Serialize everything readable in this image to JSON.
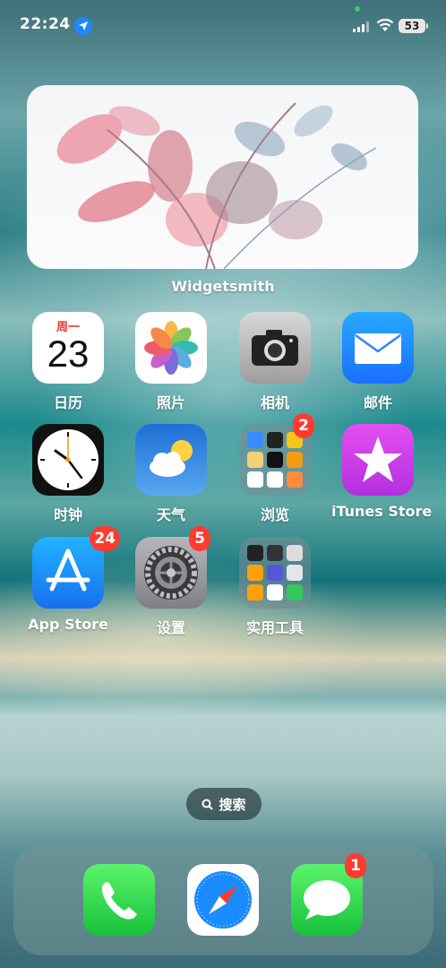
{
  "status_bar": {
    "time": "22:24",
    "battery": "53",
    "icons": [
      "location-icon",
      "signal-icon",
      "wifi-icon",
      "battery-icon"
    ]
  },
  "widget": {
    "label": "Widgetsmith"
  },
  "apps": {
    "calendar": {
      "label": "日历",
      "weekday": "周一",
      "date": "23"
    },
    "photos": {
      "label": "照片"
    },
    "camera": {
      "label": "相机"
    },
    "mail": {
      "label": "邮件"
    },
    "clock": {
      "label": "时钟"
    },
    "weather": {
      "label": "天气"
    },
    "browse": {
      "label": "浏览",
      "badge": "2"
    },
    "itunes": {
      "label": "iTunes Store"
    },
    "appstore": {
      "label": "App Store",
      "badge": "24"
    },
    "settings": {
      "label": "设置",
      "badge": "5"
    },
    "utilities": {
      "label": "实用工具"
    }
  },
  "search": {
    "label": "搜索"
  },
  "dock": {
    "phone": {
      "icon": "phone-icon"
    },
    "safari": {
      "icon": "safari-icon"
    },
    "messages": {
      "icon": "messages-icon",
      "badge": "1"
    }
  },
  "colors": {
    "badge": "#ff3b30",
    "accent": "#1e88ff"
  }
}
